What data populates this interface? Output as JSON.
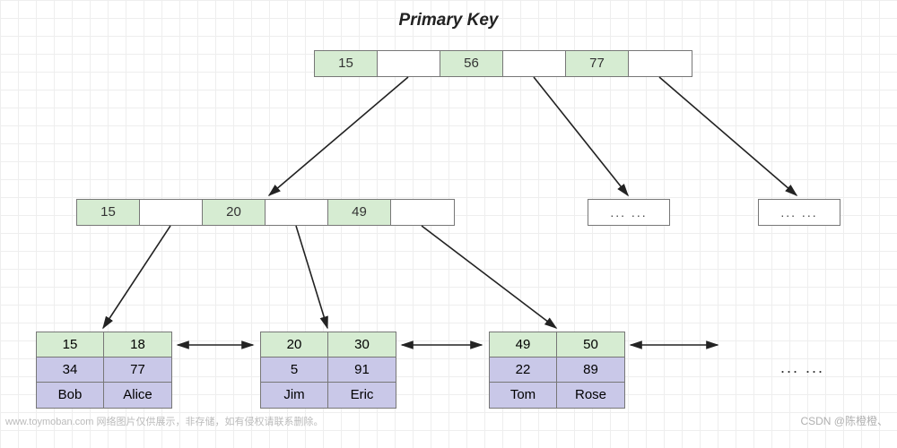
{
  "title": "Primary Key",
  "tree": {
    "root": {
      "keys": [
        "15",
        "56",
        "77"
      ]
    },
    "mid": {
      "keys": [
        "15",
        "20",
        "49"
      ]
    },
    "mid_ellipsis": [
      "... ...",
      "... ..."
    ],
    "leaves": [
      {
        "keys": [
          "15",
          "18"
        ],
        "row2": [
          "34",
          "77"
        ],
        "row3": [
          "Bob",
          "Alice"
        ]
      },
      {
        "keys": [
          "20",
          "30"
        ],
        "row2": [
          "5",
          "91"
        ],
        "row3": [
          "Jim",
          "Eric"
        ]
      },
      {
        "keys": [
          "49",
          "50"
        ],
        "row2": [
          "22",
          "89"
        ],
        "row3": [
          "Tom",
          "Rose"
        ]
      }
    ],
    "leaf_more": "... ..."
  },
  "footer": {
    "left": "www.toymoban.com 网络图片仅供展示，非存储，如有侵权请联系删除。",
    "right": "CSDN @陈橙橙、"
  },
  "chart_data": {
    "type": "tree",
    "description": "B+Tree clustered index on primary key",
    "root_keys": [
      15,
      56,
      77
    ],
    "internal_keys_child0": [
      15,
      20,
      49
    ],
    "leaf_nodes": [
      [
        {
          "pk": 15,
          "col": 34,
          "name": "Bob"
        },
        {
          "pk": 18,
          "col": 77,
          "name": "Alice"
        }
      ],
      [
        {
          "pk": 20,
          "col": 5,
          "name": "Jim"
        },
        {
          "pk": 30,
          "col": 91,
          "name": "Eric"
        }
      ],
      [
        {
          "pk": 49,
          "col": 22,
          "name": "Tom"
        },
        {
          "pk": 50,
          "col": 89,
          "name": "Rose"
        }
      ]
    ],
    "leaf_linked_list": true
  }
}
